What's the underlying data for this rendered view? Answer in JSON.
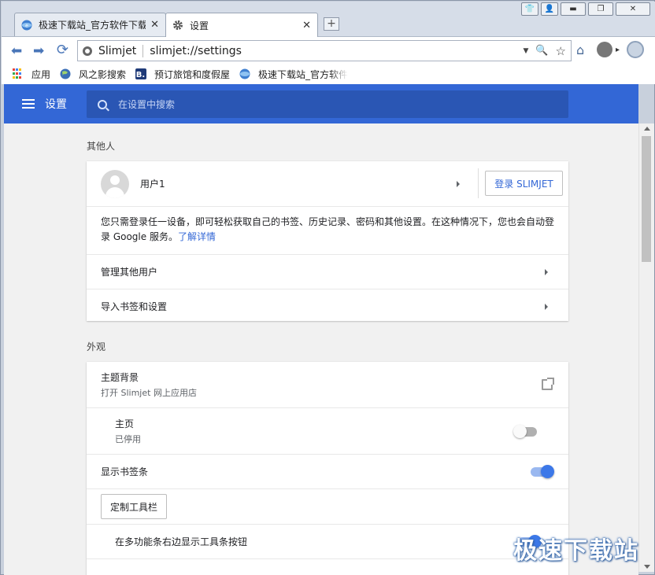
{
  "window": {
    "buttons": [
      "shirt-icon",
      "user-icon",
      "minimize-icon",
      "maximize-icon",
      "close-icon"
    ]
  },
  "tabs": [
    {
      "title": "极速下载站_官方软件下载",
      "favicon": "site-globe-icon",
      "active": false
    },
    {
      "title": "设置",
      "favicon": "gear-icon",
      "active": true
    }
  ],
  "toolbar": {
    "site_name": "Slimjet",
    "url": "slimjet://settings"
  },
  "bookmarks": [
    {
      "label": "应用",
      "icon": "apps-grid-icon"
    },
    {
      "label": "风之影搜索",
      "icon": "globe-icon"
    },
    {
      "label": "预订旅馆和度假屋",
      "icon": "booking-b-icon"
    },
    {
      "label": "极速下载站_官方软件",
      "icon": "site-globe-icon"
    }
  ],
  "header": {
    "title": "设置",
    "search_placeholder": "在设置中搜索",
    "accent": "#3367d6"
  },
  "sections": {
    "people": {
      "title": "其他人",
      "user_name": "用户1",
      "signin_label": "登录 SLIMJET",
      "description": "您只需登录任一设备，即可轻松获取自己的书签、历史记录、密码和其他设置。在这种情况下，您也会自动登录 Google 服务。",
      "learn_more": "了解详情",
      "manage_label": "管理其他用户",
      "import_label": "导入书签和设置"
    },
    "appearance": {
      "title": "外观",
      "theme_label": "主题背景",
      "theme_sub": "打开 Slimjet 网上应用店",
      "home_label": "主页",
      "home_sub": "已停用",
      "home_enabled": false,
      "bookmarks_bar_label": "显示书签条",
      "bookmarks_bar_enabled": true,
      "customize_label": "定制工具栏",
      "omnibox_buttons_label": "在多功能条右边显示工具条按钮",
      "omnibox_buttons_enabled": true
    }
  },
  "watermark": "极速下载站"
}
